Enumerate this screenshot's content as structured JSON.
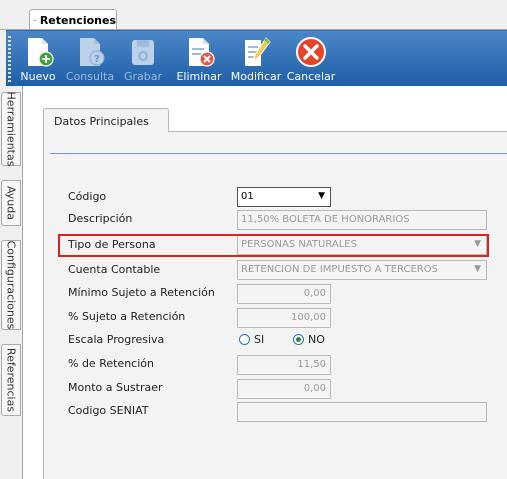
{
  "tab": {
    "title": "Retenciones"
  },
  "toolbar": {
    "nuevo": "Nuevo",
    "consulta": "Consulta",
    "grabar": "Grabar",
    "eliminar": "Eliminar",
    "modificar": "Modificar",
    "cancelar": "Cancelar"
  },
  "side_tabs": [
    "Herramientas",
    "Ayuda",
    "Configuraciones",
    "Referencias"
  ],
  "section_tab": "Datos Principales",
  "form": {
    "codigo": {
      "label": "Código",
      "value": "01"
    },
    "descripcion": {
      "label": "Descripción",
      "value": "11,50% BOLETA DE HONORARIOS"
    },
    "tipo_persona": {
      "label": "Tipo de Persona",
      "value": "PERSONAS NATURALES"
    },
    "cuenta_contable": {
      "label": "Cuenta Contable",
      "value": "RETENCION DE IMPUESTO A TERCEROS"
    },
    "minimo_sujeto": {
      "label": "Mínimo Sujeto a Retención",
      "value": "0,00"
    },
    "pct_sujeto": {
      "label": "% Sujeto a Retención",
      "value": "100,00"
    },
    "escala_progresiva": {
      "label": "Escala Progresiva",
      "opt_si": "SI",
      "opt_no": "NO",
      "selected": "NO"
    },
    "pct_retencion": {
      "label": "% de Retención",
      "value": "11,50"
    },
    "monto_sustraer": {
      "label": "Monto a Sustraer",
      "value": "0,00"
    },
    "codigo_seniat": {
      "label": "Codigo SENIAT",
      "value": ""
    }
  },
  "colors": {
    "toolbar": "#2e6ab0",
    "highlight": "#e2201f"
  }
}
